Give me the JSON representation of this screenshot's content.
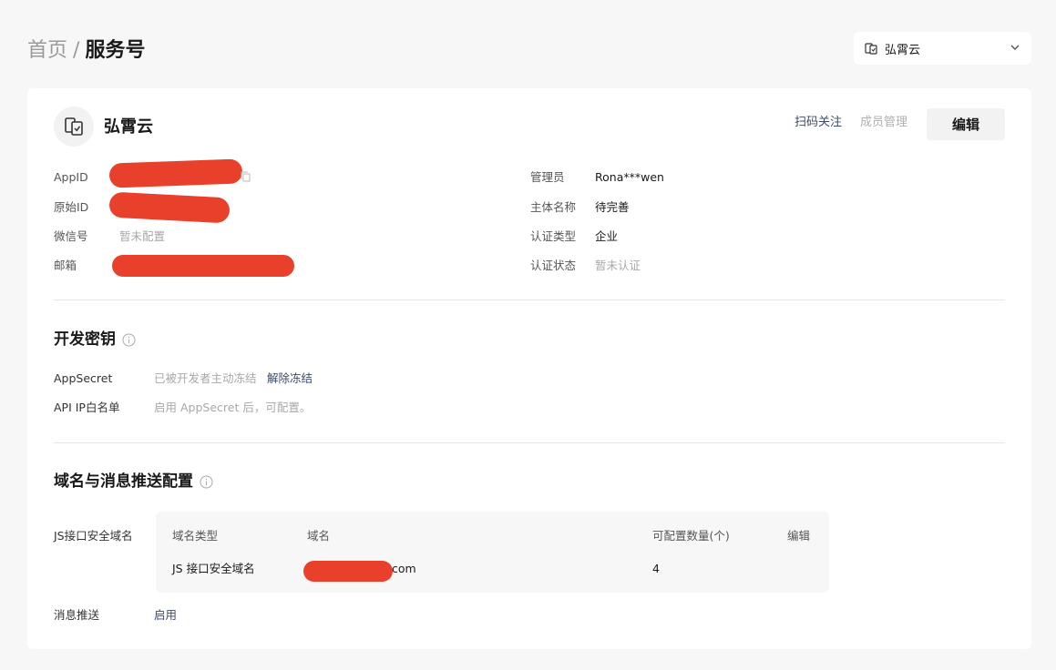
{
  "breadcrumb": {
    "home": "首页",
    "separator": "/",
    "current": "服务号"
  },
  "account_switcher": {
    "selected": "弘霄云"
  },
  "account": {
    "name": "弘霄云",
    "scan_follow": "扫码关注",
    "member_manage": "成员管理",
    "edit": "编辑"
  },
  "basic_info": {
    "left": [
      {
        "label": "AppID",
        "value": ""
      },
      {
        "label": "原始ID",
        "value": ""
      },
      {
        "label": "微信号",
        "value": "暂未配置"
      },
      {
        "label": "邮箱",
        "value": ""
      }
    ],
    "right": [
      {
        "label": "管理员",
        "value": "Rona***wen"
      },
      {
        "label": "主体名称",
        "value": "待完善"
      },
      {
        "label": "认证类型",
        "value": "企业"
      },
      {
        "label": "认证状态",
        "value": "暂未认证"
      }
    ]
  },
  "dev_keys": {
    "title": "开发密钥",
    "appsecret_label": "AppSecret",
    "appsecret_status": "已被开发者主动冻结",
    "unfreeze": "解除冻结",
    "ip_whitelist_label": "API IP白名单",
    "ip_whitelist_hint": "启用 AppSecret 后，可配置。"
  },
  "domain_push": {
    "title": "域名与消息推送配置",
    "js_domain_label": "JS接口安全域名",
    "table": {
      "headers": [
        "域名类型",
        "域名",
        "可配置数量(个)"
      ],
      "edit": "编辑",
      "rows": [
        {
          "type": "JS 接口安全域名",
          "domain_suffix": "com",
          "count": "4"
        }
      ]
    },
    "push_label": "消息推送",
    "push_action": "启用"
  },
  "colors": {
    "redaction": "#e8402a",
    "link": "#3d4a6b",
    "muted": "#a8a8a8"
  }
}
